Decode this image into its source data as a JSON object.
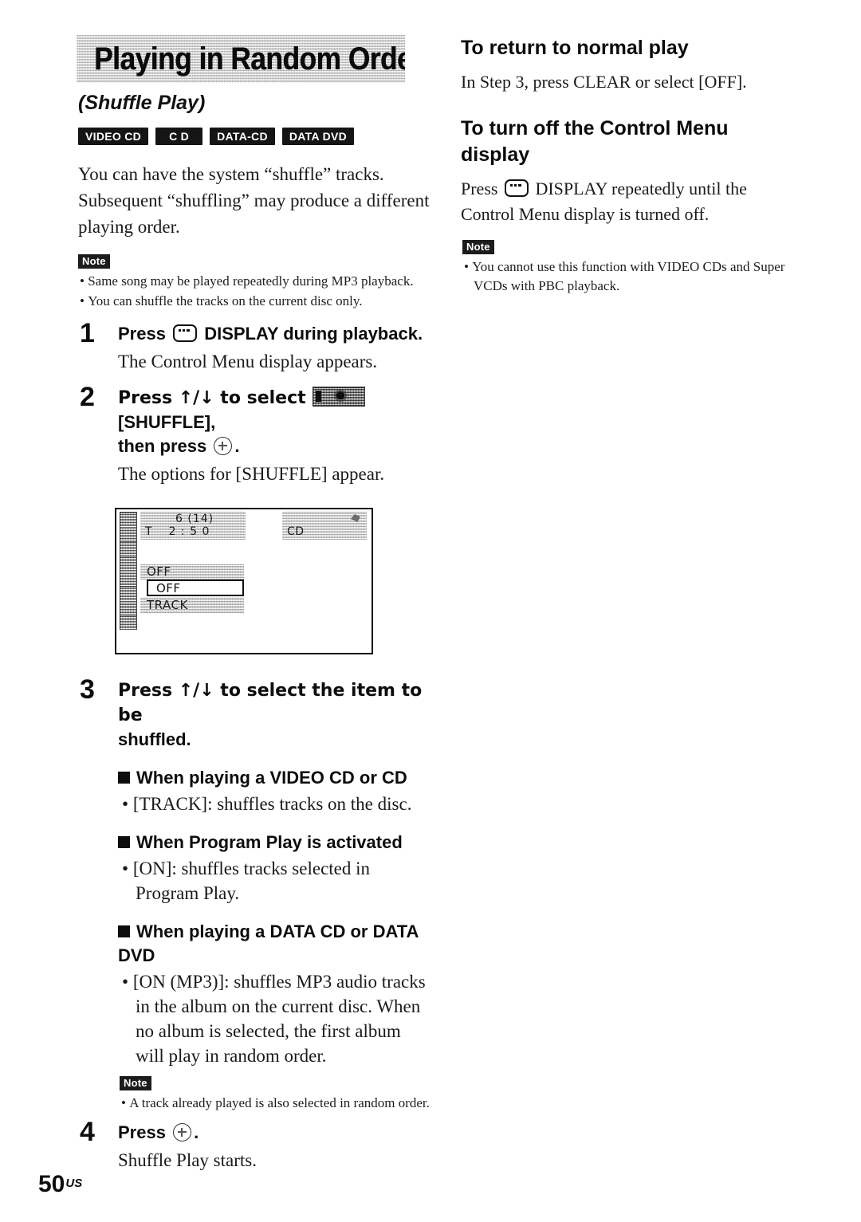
{
  "section": {
    "title": "Playing in Random Order",
    "subtitle": "(Shuffle Play)",
    "badges": [
      "VIDEO CD",
      "C D",
      "DATA-CD",
      "DATA DVD"
    ],
    "intro": "You can have the system “shuffle” tracks. Subsequent “shuffling” may produce a different playing order.",
    "note_label": "Note",
    "notes": [
      "Same song may be played repeatedly during MP3 playback.",
      "You can shuffle the tracks on the current disc only."
    ]
  },
  "steps": [
    {
      "num": "1",
      "head_pre": "Press",
      "head_post": "DISPLAY during playback.",
      "body": "The Control Menu display appears."
    },
    {
      "num": "2",
      "head_pre": "Press ↑/↓ to select",
      "head_mid": "[SHUFFLE],",
      "head_line2_pre": "then press",
      "head_line2_post": ".",
      "body": "The options for [SHUFFLE] appear."
    },
    {
      "num": "3",
      "head_line1": "Press ↑/↓ to select the item to be",
      "head_line2": "shuffled."
    },
    {
      "num": "4",
      "head_pre": "Press",
      "head_post": "."
    }
  ],
  "osd": {
    "track_number": "6 (14)",
    "time_label": "T",
    "time_value": "2 : 5 0",
    "disc_label": "CD",
    "option_current": "OFF",
    "option_selected": "OFF",
    "option_third": "TRACK"
  },
  "step3_sections": [
    {
      "head": "When playing a VIDEO CD or CD",
      "bullet": "[TRACK]: shuffles tracks on the disc."
    },
    {
      "head": "When Program Play is activated",
      "bullet": "[ON]: shuffles tracks selected in Program Play."
    },
    {
      "head": "When playing a DATA CD or DATA DVD",
      "bullet": "[ON (MP3)]: shuffles MP3 audio tracks in the album on the current disc. When no album is selected, the first album will play in random order."
    }
  ],
  "step3_note": {
    "label": "Note",
    "items": [
      "A track already played is also selected in random order."
    ]
  },
  "step4_body": "Shuffle Play starts.",
  "right": {
    "head1": "To return to normal play",
    "body1": "In Step 3, press CLEAR or select [OFF].",
    "head2_line1": "To turn off the Control Menu",
    "head2_line2": "display",
    "body2_pre": "Press",
    "body2_post": "DISPLAY repeatedly until the Control Menu display is turned off.",
    "note_label": "Note",
    "notes": [
      "You cannot use this function with VIDEO CDs and Super VCDs with PBC playback."
    ]
  },
  "footer": {
    "page_number": "50",
    "page_suffix": "US"
  }
}
